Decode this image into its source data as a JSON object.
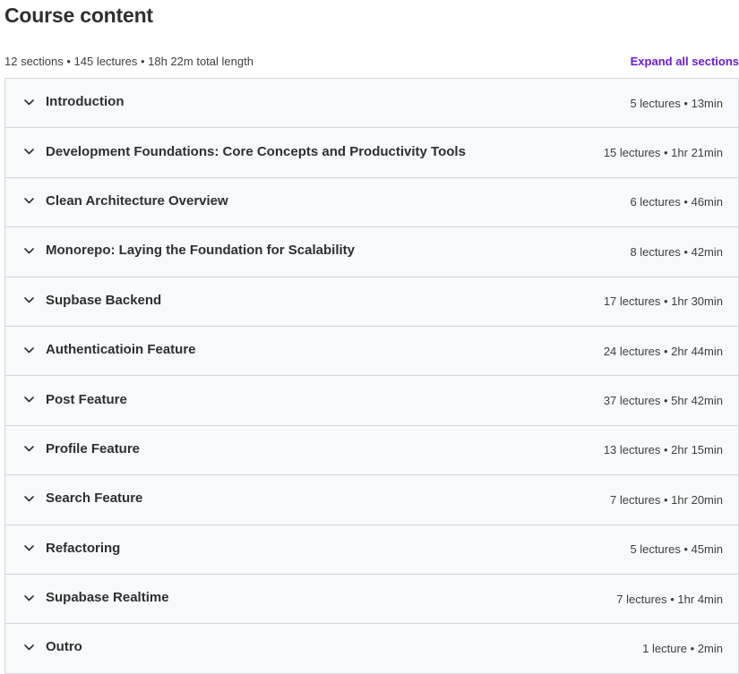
{
  "header": {
    "title": "Course content",
    "summary": "12 sections • 145 lectures • 18h 22m total length",
    "expand_all_label": "Expand all sections"
  },
  "icons": {
    "section_toggle": "chevron-down-icon"
  },
  "colors": {
    "accent": "#6a1bd8",
    "section_bg": "#f7f9fa",
    "border": "#d1d7dc",
    "text": "#2d2f31"
  },
  "sections": [
    {
      "title": "Introduction",
      "meta": "5 lectures • 13min"
    },
    {
      "title": "Development Foundations: Core Concepts and Productivity Tools",
      "meta": "15 lectures • 1hr 21min"
    },
    {
      "title": "Clean Architecture Overview",
      "meta": "6 lectures • 46min"
    },
    {
      "title": "Monorepo: Laying the Foundation for Scalability",
      "meta": "8 lectures • 42min"
    },
    {
      "title": "Supbase Backend",
      "meta": "17 lectures • 1hr 30min"
    },
    {
      "title": "Authenticatioin Feature",
      "meta": "24 lectures • 2hr 44min"
    },
    {
      "title": "Post Feature",
      "meta": "37 lectures • 5hr 42min"
    },
    {
      "title": "Profile Feature",
      "meta": "13 lectures • 2hr 15min"
    },
    {
      "title": "Search Feature",
      "meta": "7 lectures • 1hr 20min"
    },
    {
      "title": "Refactoring",
      "meta": "5 lectures • 45min"
    },
    {
      "title": "Supabase Realtime",
      "meta": "7 lectures • 1hr 4min"
    },
    {
      "title": "Outro",
      "meta": "1 lecture • 2min"
    }
  ]
}
